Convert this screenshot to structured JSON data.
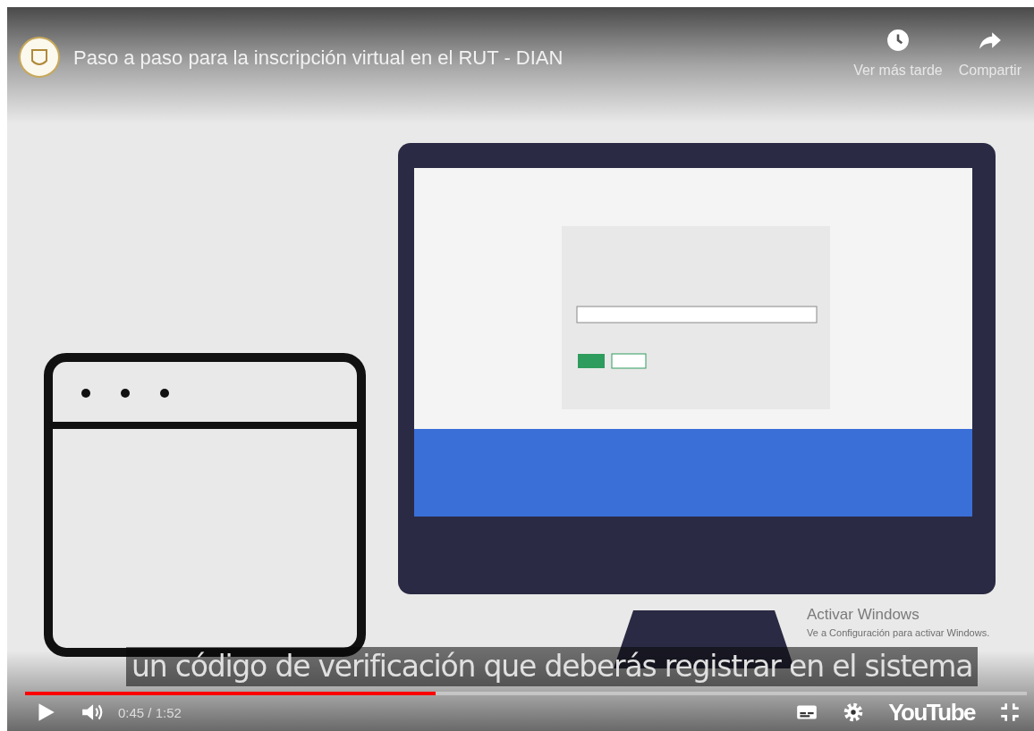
{
  "player": {
    "title": "Paso a paso para la inscripción virtual en el RUT - DIAN",
    "actions": [
      {
        "kind": "clock",
        "label": "Ver más tarde"
      },
      {
        "kind": "share",
        "label": "Compartir"
      }
    ],
    "caption": "un código de verificación que deberás registrar en el sistema",
    "progress": {
      "level": 0.41
    },
    "time": "0:45 / 1:52",
    "logo": "YouTube"
  },
  "os_notice": {
    "title": "Activar Windows",
    "subtitle": "Ve a Configuración para activar Windows."
  }
}
